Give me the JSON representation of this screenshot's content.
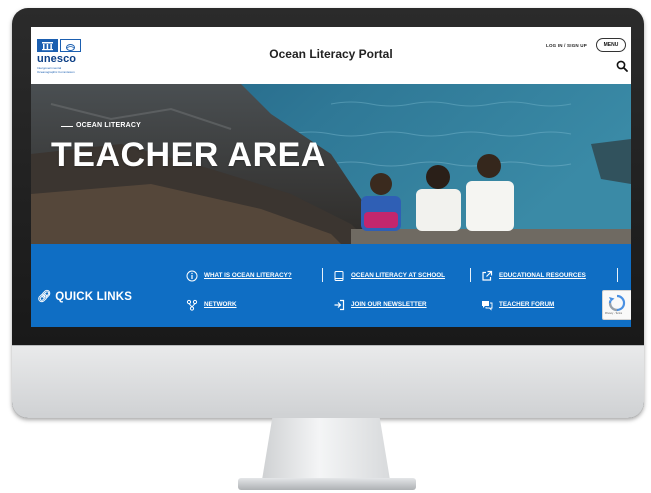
{
  "header": {
    "logo_word": "unesco",
    "logo_subtext": "Intergovernmental Oceanographic Commission",
    "site_title": "Ocean Literacy Portal",
    "login_label": "LOG IN / SIGN UP",
    "menu_label": "MENU"
  },
  "hero": {
    "eyebrow": "OCEAN LITERACY",
    "title": "TEACHER AREA"
  },
  "quick_links": {
    "title": "QUICK LINKS",
    "items": [
      {
        "label": "WHAT IS OCEAN LITERACY?",
        "icon": "info-icon"
      },
      {
        "label": "OCEAN LITERACY AT SCHOOL",
        "icon": "book-icon"
      },
      {
        "label": "EDUCATIONAL RESOURCES",
        "icon": "external-link-icon"
      },
      {
        "label": "NETWORK",
        "icon": "network-icon"
      },
      {
        "label": "JOIN OUR NEWSLETTER",
        "icon": "sign-in-icon"
      },
      {
        "label": "TEACHER FORUM",
        "icon": "chat-icon"
      }
    ]
  },
  "recaptcha": {
    "footer": "Privacy - Terms"
  },
  "colors": {
    "brand_blue": "#0f6ec4",
    "unesco_blue": "#1b5fb0"
  }
}
